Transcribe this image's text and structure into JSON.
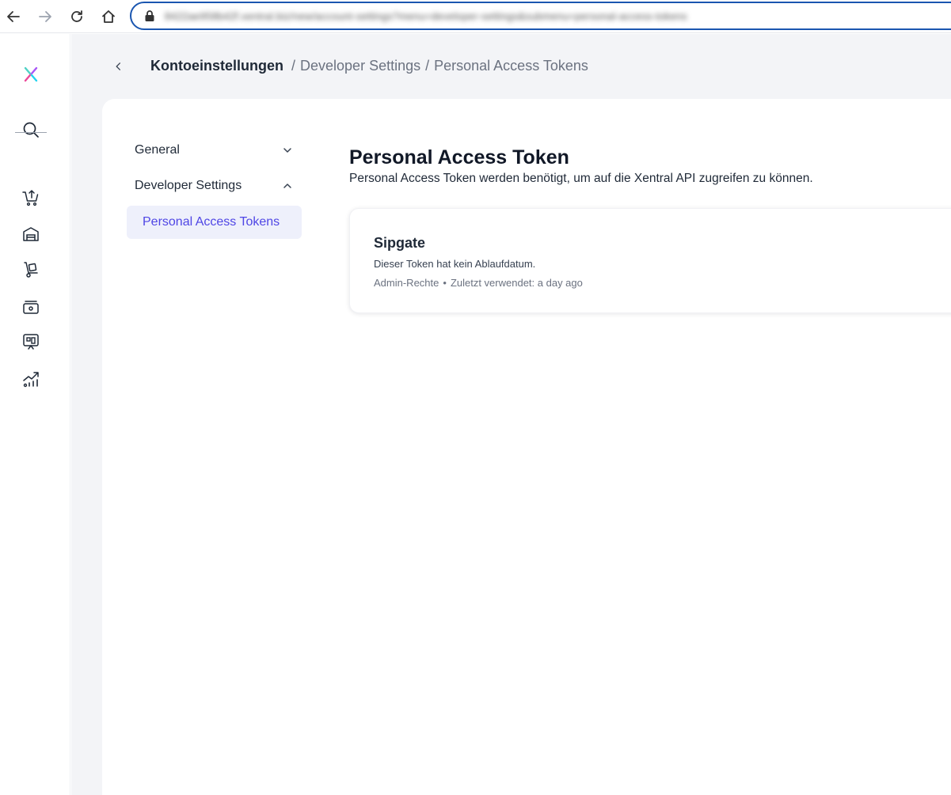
{
  "browser": {
    "url": "8422ae958b42f.xentral.biz/new/account-settings?menu=developer-settings&submenu=personal-access-tokens"
  },
  "rail": {
    "items": [
      {
        "icon": "xentral-logo-icon"
      },
      {
        "icon": "search-icon"
      },
      {
        "icon": "cart-upload-icon"
      },
      {
        "icon": "warehouse-icon"
      },
      {
        "icon": "hand-truck-icon"
      },
      {
        "icon": "cash-register-icon"
      },
      {
        "icon": "presentation-board-icon"
      },
      {
        "icon": "analytics-chart-icon"
      }
    ]
  },
  "header": {
    "breadcrumb_root": "Kontoeinstellungen",
    "separator": "/",
    "breadcrumb_items": [
      "Developer Settings",
      "Personal Access Tokens"
    ]
  },
  "settings_menu": {
    "general_label": "General",
    "developer_label": "Developer Settings",
    "personal_tokens_label": "Personal Access Tokens"
  },
  "content": {
    "title": "Personal Access Token",
    "description": "Personal Access Token werden benötigt, um auf die Xentral API zugreifen zu können."
  },
  "tokens": [
    {
      "name": "Sipgate",
      "expiry": "Dieser Token hat kein Ablaufdatum.",
      "rights": "Admin-Rechte",
      "last_used": "Zuletzt verwendet: a day ago"
    }
  ],
  "colors": {
    "accent": "#4f46e5",
    "accent_bg": "#eef0fb",
    "address_border": "#1a56b0",
    "app_bg": "#f3f4f7"
  }
}
